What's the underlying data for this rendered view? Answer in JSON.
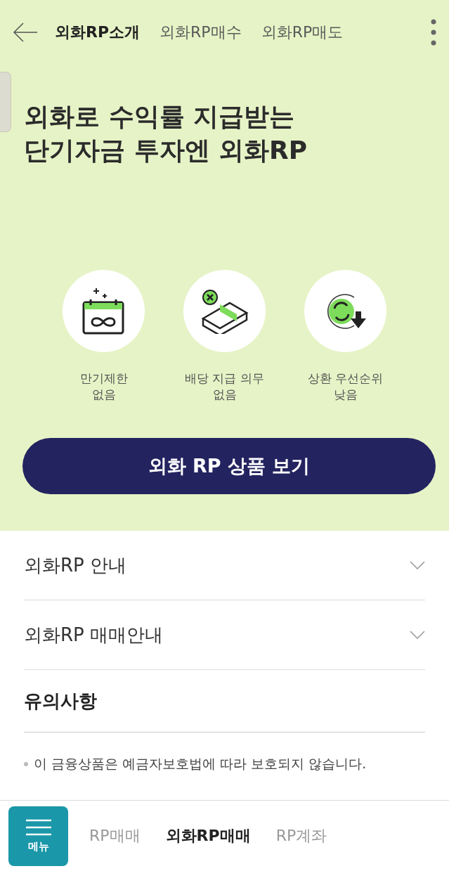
{
  "header": {
    "tabs": [
      {
        "label": "외화RP소개",
        "selected": true
      },
      {
        "label": "외화RP매수",
        "selected": false
      },
      {
        "label": "외화RP매도",
        "selected": false
      }
    ]
  },
  "hero": {
    "title_lines": [
      "외화로 수익률 지급받는",
      "단기자금 투자엔 외화RP"
    ],
    "features": [
      {
        "kind": "calendar",
        "lines": [
          "만기제한",
          "없음"
        ]
      },
      {
        "kind": "money",
        "lines": [
          "배당 지급 의무",
          "없음"
        ]
      },
      {
        "kind": "refresh",
        "lines": [
          "상환 우선순위",
          "낮음"
        ]
      }
    ],
    "cta": "외화 RP 상품 보기"
  },
  "sections": [
    {
      "title": "외화RP 안내",
      "expanded": false
    },
    {
      "title": "외화RP 매매안내",
      "expanded": false
    }
  ],
  "notice": {
    "title": "유의사항",
    "items": [
      "이 금융상품은 예금자보호법에 따라 보호되지 않습니다."
    ]
  },
  "bottom_bar": {
    "menu_label": "메뉴",
    "tabs": [
      {
        "label": "RP매매",
        "selected": false
      },
      {
        "label": "외화RP매매",
        "selected": true
      },
      {
        "label": "RP계좌",
        "selected": false
      }
    ]
  }
}
